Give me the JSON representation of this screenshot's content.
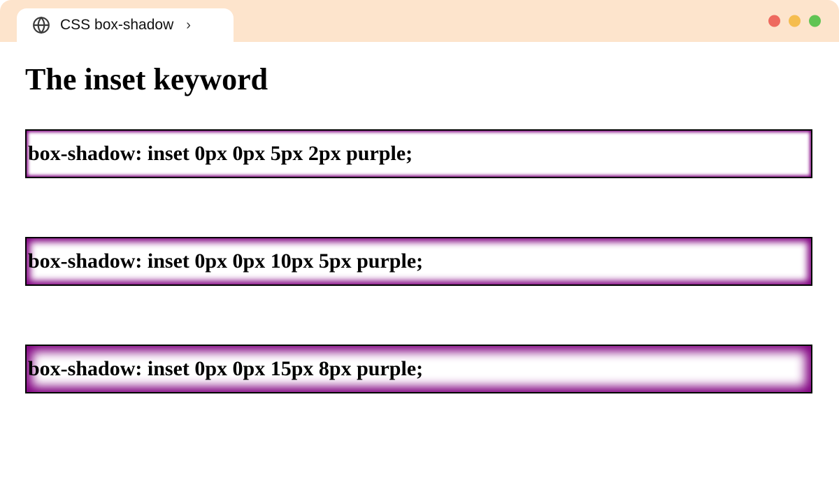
{
  "tab": {
    "title": "CSS box-shadow",
    "chevron": "›"
  },
  "traffic_lights": {
    "close_color": "#ee6a5f",
    "minimize_color": "#f5bd4f",
    "zoom_color": "#61c454"
  },
  "page": {
    "heading": "The inset keyword"
  },
  "examples": [
    {
      "text": "box-shadow: inset 0px 0px 5px 2px purple;"
    },
    {
      "text": "box-shadow: inset 0px 0px 10px 5px purple;"
    },
    {
      "text": "box-shadow: inset 0px 0px 15px 8px purple;"
    }
  ]
}
